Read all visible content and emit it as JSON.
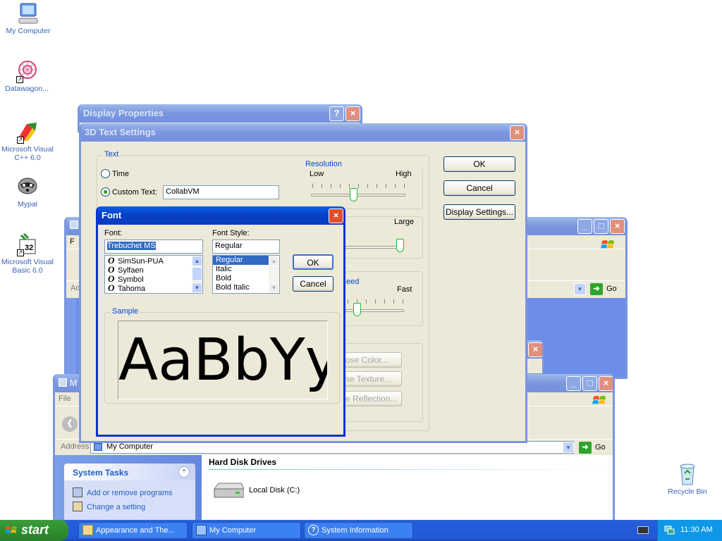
{
  "desktop": {
    "icons": [
      {
        "label": "My Computer"
      },
      {
        "label": "Datawagon..."
      },
      {
        "label": "Microsoft Visual C++ 6.0"
      },
      {
        "label": "Mypal"
      },
      {
        "label": "Microsoft Visual Basic 6.0"
      },
      {
        "label": "Recycle Bin"
      }
    ]
  },
  "explorer_back": {
    "menu_first": "F",
    "address_label": "Ad",
    "go_label": "Go"
  },
  "explorer_front": {
    "title_char": "M",
    "menu_file": "File",
    "address_label": "Address",
    "address_value": "My Computer",
    "go_label": "Go",
    "system_tasks": {
      "title": "System Tasks",
      "items": [
        "Add or remove programs",
        "Change a setting"
      ]
    },
    "section_title": "Hard Disk Drives",
    "drive_label": "Local Disk (C:)"
  },
  "display_properties": {
    "title": "Display Properties",
    "help_label": "?"
  },
  "text_settings": {
    "title": "3D Text Settings",
    "text_group": "Text",
    "radio_time": "Time",
    "radio_custom": "Custom Text:",
    "custom_value": "CollabVM",
    "resolution": {
      "label": "Resolution",
      "low": "Low",
      "high": "High",
      "level": 0.45
    },
    "size": {
      "large": "Large",
      "level": 1.0
    },
    "speed": {
      "label_fragment": "eed",
      "fast": "Fast",
      "level": 0.45
    },
    "buttons_right": {
      "ok": "OK",
      "cancel": "Cancel",
      "display_settings": "Display Settings..."
    },
    "disabled_buttons": [
      "ose Color...",
      "se Texture...",
      "e Reflection..."
    ]
  },
  "font_dialog": {
    "title": "Font",
    "font_label": "Font:",
    "font_value": "Trebuchet MS",
    "font_list": [
      "SimSun-PUA",
      "Sylfaen",
      "Symbol",
      "Tahoma"
    ],
    "style_label": "Font Style:",
    "style_value": "Regular",
    "style_list": [
      "Regular",
      "Italic",
      "Bold",
      "Bold Italic"
    ],
    "ok": "OK",
    "cancel": "Cancel",
    "sample_label": "Sample",
    "sample_text": "AaBbYy"
  },
  "taskbar": {
    "start_label": "start",
    "items": [
      "Appearance and The...",
      "My Computer",
      "System Information"
    ],
    "clock": "11:30 AM"
  },
  "colors": {
    "xp_blue": "#0831d9",
    "start_green": "#3c9c3c",
    "selection": "#316ac5",
    "group_label": "#0046d5"
  }
}
